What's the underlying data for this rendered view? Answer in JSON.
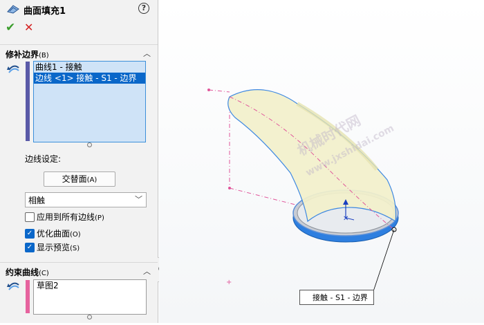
{
  "feature": {
    "title": "曲面填充1",
    "help_glyph": "?",
    "ok_glyph": "✔",
    "cancel_glyph": "✕"
  },
  "patch_boundary": {
    "header": "修补边界",
    "shortcut": "(B)",
    "items": [
      "曲线1 - 接触",
      "边线 <1> 接触 - S1 - 边界"
    ],
    "selected_index": 1,
    "edge_settings_label": "边线设定:",
    "alternate_face_button": "交替面",
    "alternate_face_shortcut": "(A)",
    "condition_value": "相触",
    "apply_all_edges": {
      "label": "应用到所有边线",
      "shortcut": "(P)",
      "checked": false
    },
    "optimize_surface": {
      "label": "优化曲面",
      "shortcut": "(O)",
      "checked": true
    },
    "show_preview": {
      "label": "显示预览",
      "shortcut": "(S)",
      "checked": true
    }
  },
  "constraint_curves": {
    "header": "约束曲线",
    "shortcut": "(C)",
    "items": [
      "草图2"
    ]
  },
  "callout": {
    "text": "接触 - S1 - 边界"
  },
  "watermark": {
    "line1": "机械时代网",
    "line2": "www.jxshidai.com"
  },
  "colors": {
    "accent": "#0a67c9",
    "preview_yellow": "#f3f1cc",
    "edge_blue": "#2e7fe0",
    "sketch_pink": "#e0559a",
    "purple_bar": "#5a5aa8",
    "pink_bar": "#e6639e"
  }
}
